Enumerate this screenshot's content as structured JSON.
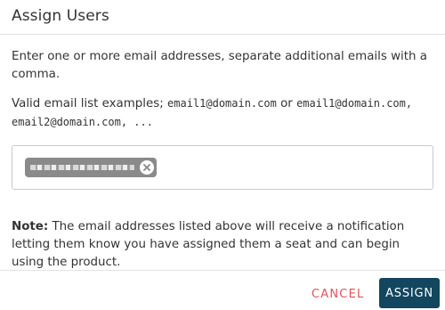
{
  "dialog": {
    "title": "Assign Users",
    "instructions": "Enter one or more email addresses, separate additional emails with a comma.",
    "examples": {
      "prefix": "Valid email list examples; ",
      "example1": "email1@domain.com",
      "separator": " or ",
      "example2": "email1@domain.com, email2@domain.com, ..."
    },
    "email_input": {
      "chips": [
        {
          "label": "redacted email address",
          "remove_icon": "close-circle-icon"
        }
      ]
    },
    "note": {
      "label": "Note:",
      "text": " The email addresses listed above will receive a notification letting them know you have assigned them a seat and can begin using the product."
    },
    "footer": {
      "cancel_label": "CANCEL",
      "assign_label": "ASSIGN"
    }
  },
  "colors": {
    "primary": "#12475f",
    "cancel": "#e0535b",
    "chip": "#8a8a8a",
    "border": "#c9c9c9"
  }
}
